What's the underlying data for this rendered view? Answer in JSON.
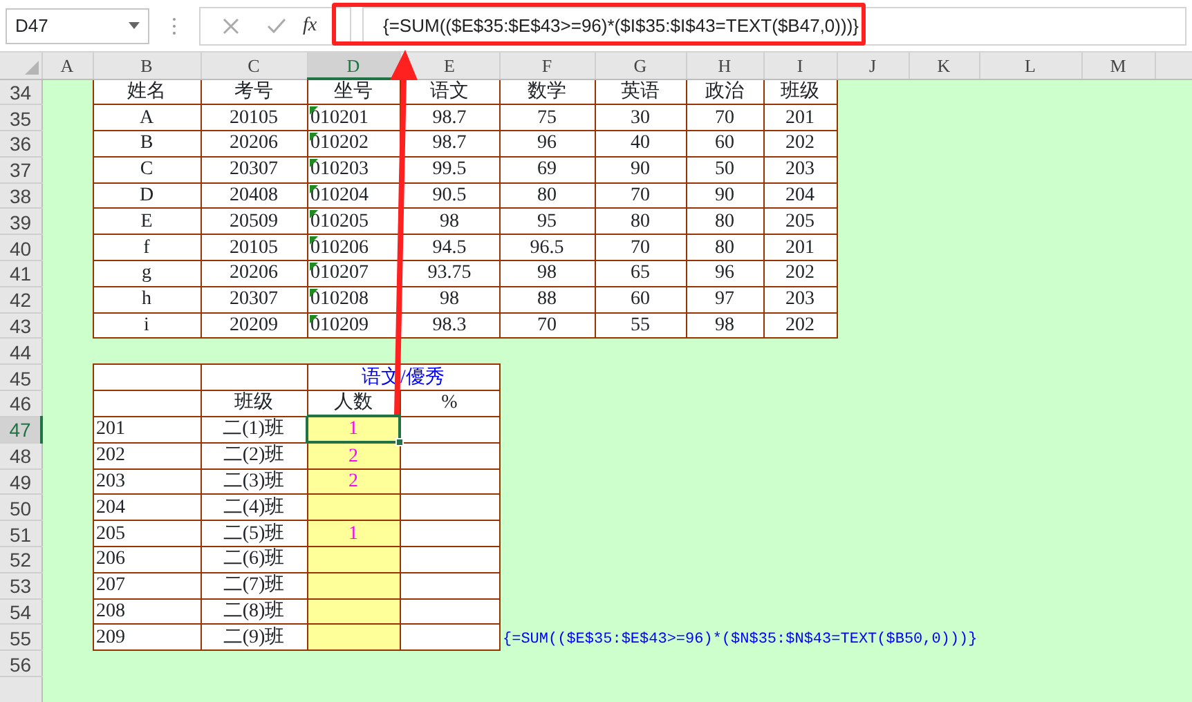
{
  "name_box": {
    "value": "D47"
  },
  "formula_bar": {
    "function_label": "fx",
    "value": "{=SUM(($E$35:$E$43>=96)*($I$35:$I$43=TEXT($B47,0)))}",
    "highlighted": true
  },
  "columns": [
    {
      "label": "A",
      "selected": false
    },
    {
      "label": "B",
      "selected": false
    },
    {
      "label": "C",
      "selected": false
    },
    {
      "label": "D",
      "selected": true
    },
    {
      "label": "E",
      "selected": false
    },
    {
      "label": "F",
      "selected": false
    },
    {
      "label": "G",
      "selected": false
    },
    {
      "label": "H",
      "selected": false
    },
    {
      "label": "I",
      "selected": false
    },
    {
      "label": "J",
      "selected": false
    },
    {
      "label": "K",
      "selected": false
    },
    {
      "label": "L",
      "selected": false
    },
    {
      "label": "M",
      "selected": false
    }
  ],
  "rows": [
    {
      "label": "34",
      "selected": false
    },
    {
      "label": "35",
      "selected": false
    },
    {
      "label": "36",
      "selected": false
    },
    {
      "label": "37",
      "selected": false
    },
    {
      "label": "38",
      "selected": false
    },
    {
      "label": "39",
      "selected": false
    },
    {
      "label": "40",
      "selected": false
    },
    {
      "label": "41",
      "selected": false
    },
    {
      "label": "42",
      "selected": false
    },
    {
      "label": "43",
      "selected": false
    },
    {
      "label": "44",
      "selected": false
    },
    {
      "label": "45",
      "selected": false
    },
    {
      "label": "46",
      "selected": false
    },
    {
      "label": "47",
      "selected": true
    },
    {
      "label": "48",
      "selected": false
    },
    {
      "label": "49",
      "selected": false
    },
    {
      "label": "50",
      "selected": false
    },
    {
      "label": "51",
      "selected": false
    },
    {
      "label": "52",
      "selected": false
    },
    {
      "label": "53",
      "selected": false
    },
    {
      "label": "54",
      "selected": false
    },
    {
      "label": "55",
      "selected": false
    },
    {
      "label": "56",
      "selected": false
    }
  ],
  "scores_table": {
    "columns": [
      "姓名",
      "考号",
      "坐号",
      "语文",
      "数学",
      "英语",
      "政治",
      "班级"
    ],
    "rows": [
      {
        "cells": [
          "A",
          "20105",
          "010201",
          "98.7",
          "75",
          "30",
          "70",
          "201"
        ],
        "seat_flagged": true
      },
      {
        "cells": [
          "B",
          "20206",
          "010202",
          "98.7",
          "96",
          "40",
          "60",
          "202"
        ],
        "seat_flagged": true
      },
      {
        "cells": [
          "C",
          "20307",
          "010203",
          "99.5",
          "69",
          "90",
          "50",
          "203"
        ],
        "seat_flagged": true
      },
      {
        "cells": [
          "D",
          "20408",
          "010204",
          "90.5",
          "80",
          "70",
          "90",
          "204"
        ],
        "seat_flagged": true
      },
      {
        "cells": [
          "E",
          "20509",
          "010205",
          "98",
          "95",
          "80",
          "80",
          "205"
        ],
        "seat_flagged": true
      },
      {
        "cells": [
          "f",
          "20105",
          "010206",
          "94.5",
          "96.5",
          "70",
          "80",
          "201"
        ],
        "seat_flagged": true
      },
      {
        "cells": [
          "g",
          "20206",
          "010207",
          "93.75",
          "98",
          "65",
          "96",
          "202"
        ],
        "seat_flagged": true
      },
      {
        "cells": [
          "h",
          "20307",
          "010208",
          "98",
          "88",
          "60",
          "97",
          "203"
        ],
        "seat_flagged": true
      },
      {
        "cells": [
          "i",
          "20209",
          "010209",
          "98.3",
          "70",
          "55",
          "98",
          "202"
        ],
        "seat_flagged": true
      }
    ]
  },
  "summary_table": {
    "title": "语文/優秀",
    "columns": [
      "班级",
      "人数",
      "%"
    ],
    "rows": [
      {
        "code": "201",
        "class": "二(1)班",
        "count": "1",
        "selected": true
      },
      {
        "code": "202",
        "class": "二(2)班",
        "count": "2",
        "selected": false
      },
      {
        "code": "203",
        "class": "二(3)班",
        "count": "2",
        "selected": false
      },
      {
        "code": "204",
        "class": "二(4)班",
        "selected": false
      },
      {
        "code": "205",
        "class": "二(5)班",
        "count": "1",
        "selected": false
      },
      {
        "code": "206",
        "class": "二(6)班",
        "selected": false
      },
      {
        "code": "207",
        "class": "二(7)班",
        "selected": false
      },
      {
        "code": "208",
        "class": "二(8)班",
        "selected": false
      },
      {
        "code": "209",
        "class": "二(9)班",
        "selected": false
      }
    ]
  },
  "note": {
    "text": "{=SUM(($E$35:$E$43>=96)*($N$35:$N$43=TEXT($B50,0)))}"
  }
}
